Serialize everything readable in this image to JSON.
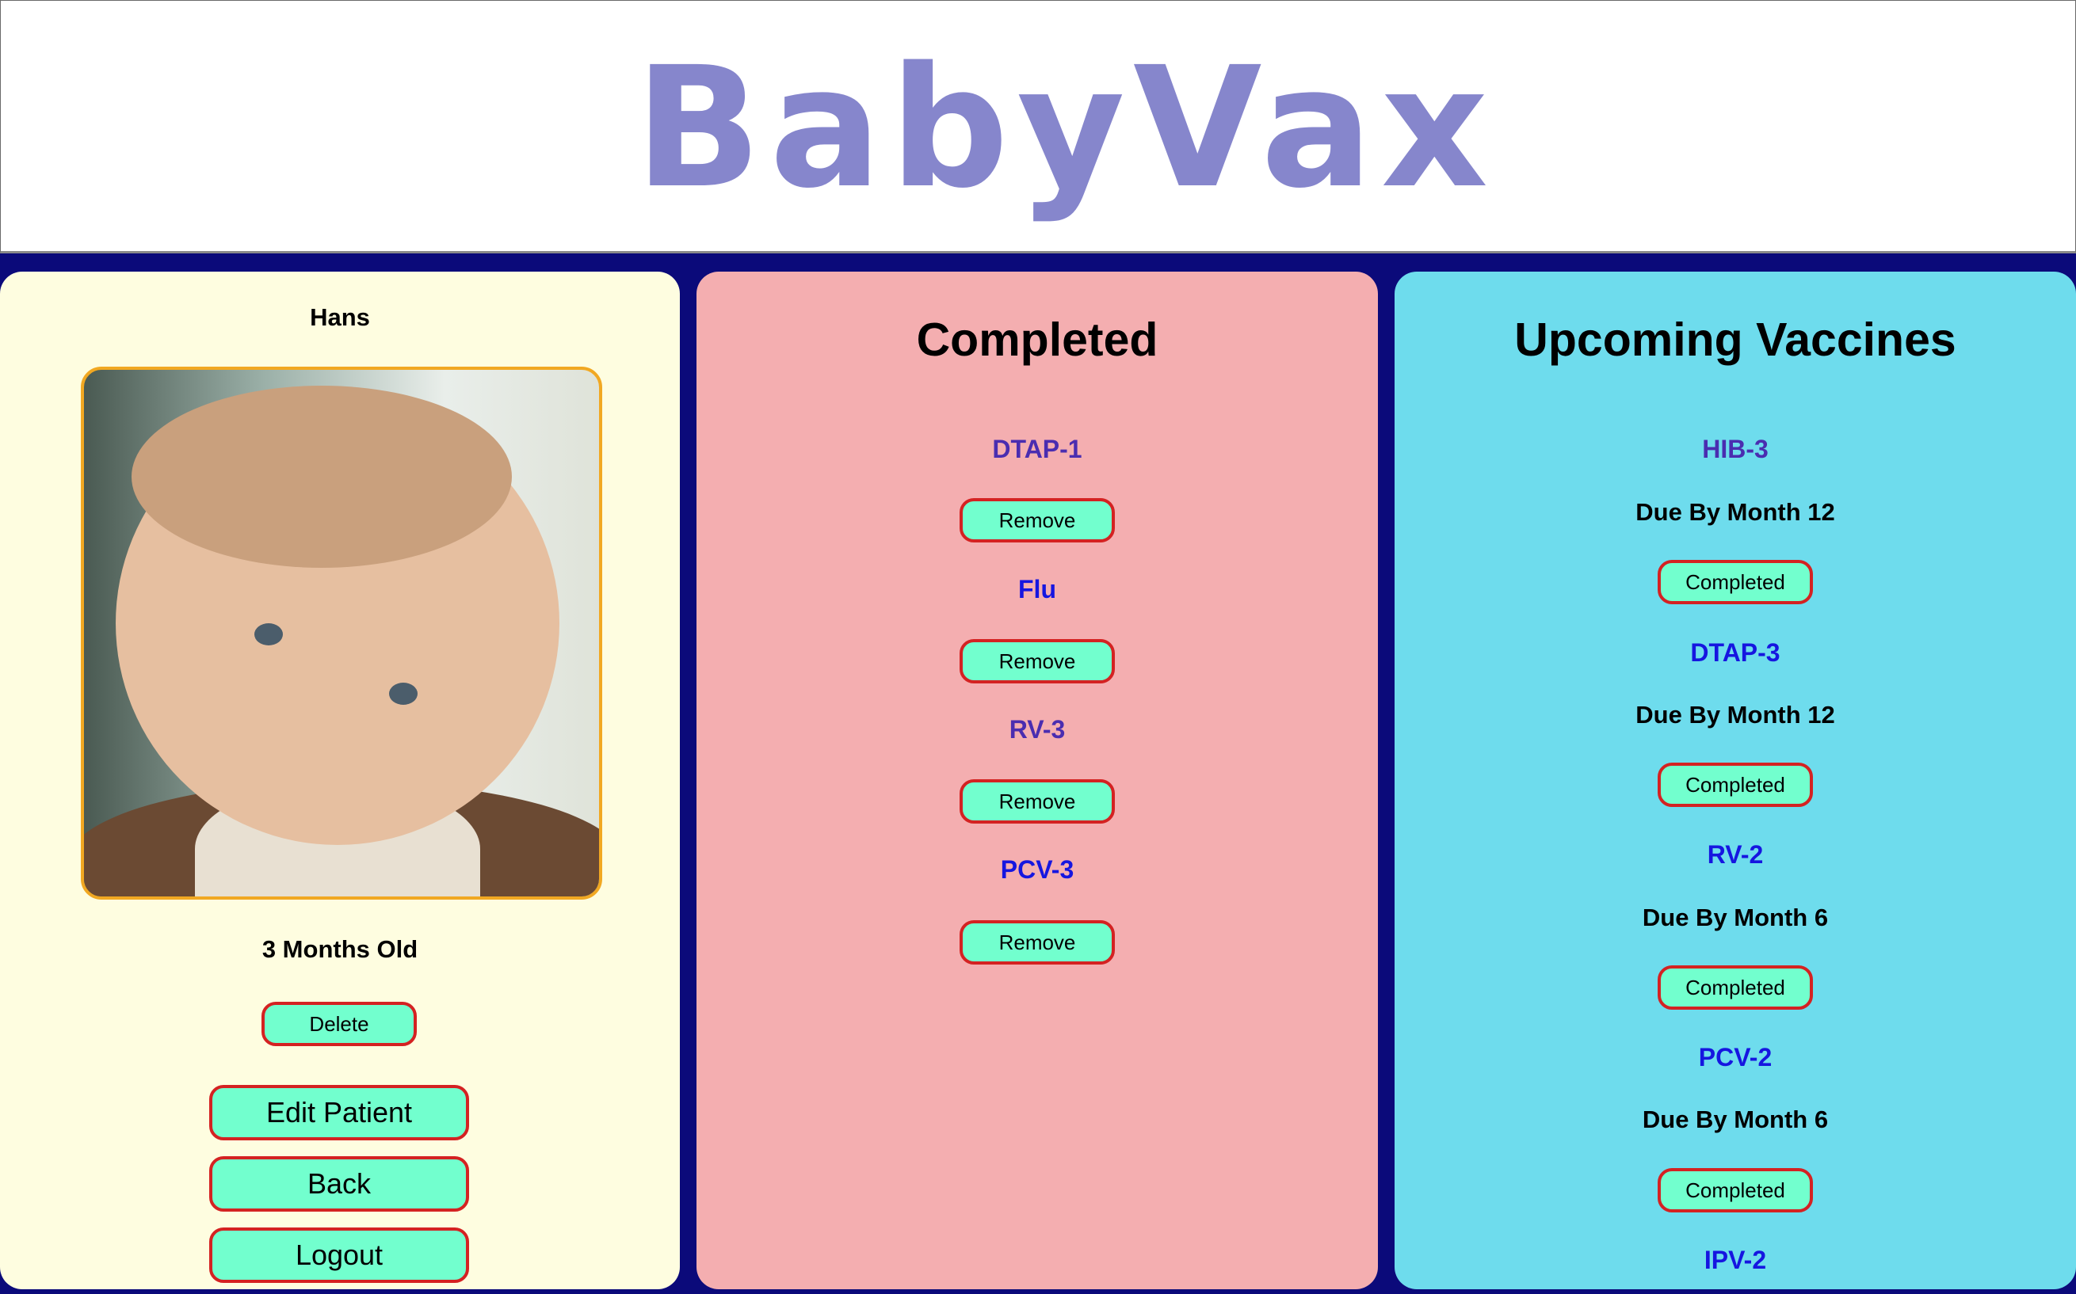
{
  "app": {
    "logo_text": "BabyVax"
  },
  "banner": {
    "hat_colors": [
      "#4dc3ea",
      "#e8102a",
      "#8bd12a",
      "#ffc10a",
      "#4dc3ea",
      "#e8102a",
      "#8bd12a",
      "#ffc10a"
    ]
  },
  "patient": {
    "name": "Hans",
    "age": "3 Months Old",
    "delete_label": "Delete",
    "edit_label": "Edit Patient",
    "back_label": "Back",
    "logout_label": "Logout"
  },
  "completed": {
    "heading": "Completed",
    "items": [
      {
        "name": "DTAP-1",
        "action": "Remove"
      },
      {
        "name": "Flu",
        "action": "Remove"
      },
      {
        "name": "RV-3",
        "action": "Remove"
      },
      {
        "name": "PCV-3",
        "action": "Remove"
      }
    ]
  },
  "upcoming": {
    "heading": "Upcoming Vaccines",
    "items": [
      {
        "name": "HIB-3",
        "due": "Due By Month 12",
        "action": "Completed"
      },
      {
        "name": "DTAP-3",
        "due": "Due By Month 12",
        "action": "Completed"
      },
      {
        "name": "RV-2",
        "due": "Due By Month 6",
        "action": "Completed"
      },
      {
        "name": "PCV-2",
        "due": "Due By Month 6",
        "action": "Completed"
      },
      {
        "name": "IPV-2"
      }
    ]
  }
}
